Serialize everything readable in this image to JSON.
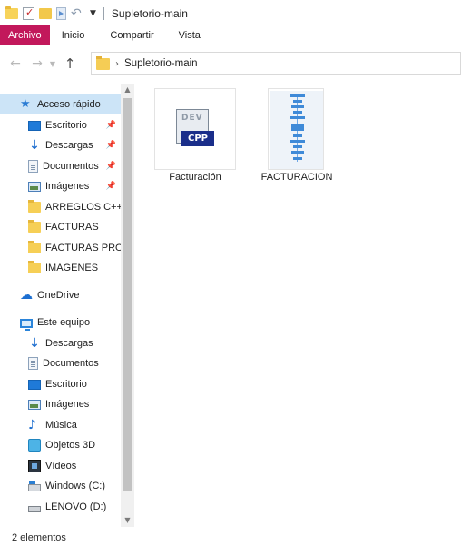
{
  "window": {
    "title": "Supletorio-main"
  },
  "quick_access_icons": [
    "folder-icon",
    "properties-icon",
    "new-folder-icon",
    "document-icon",
    "undo-icon",
    "chevron-down-icon"
  ],
  "ribbon": {
    "tabs": [
      {
        "label": "Archivo",
        "active": true,
        "color": "#c2185b"
      },
      {
        "label": "Inicio"
      },
      {
        "label": "Compartir"
      },
      {
        "label": "Vista"
      }
    ]
  },
  "address": {
    "path": [
      "Supletorio-main"
    ]
  },
  "sidebar": {
    "quick_access_label": "Acceso rápido",
    "quick_items": [
      {
        "label": "Escritorio",
        "icon": "desktop-icon",
        "pinned": true
      },
      {
        "label": "Descargas",
        "icon": "download-icon",
        "pinned": true
      },
      {
        "label": "Documentos",
        "icon": "documents-icon",
        "pinned": true
      },
      {
        "label": "Imágenes",
        "icon": "pictures-icon",
        "pinned": true
      },
      {
        "label": "ARREGLOS C++",
        "icon": "folder-icon"
      },
      {
        "label": "FACTURAS",
        "icon": "folder-icon"
      },
      {
        "label": "FACTURAS PROD",
        "icon": "folder-icon"
      },
      {
        "label": "IMAGENES",
        "icon": "folder-icon"
      }
    ],
    "onedrive_label": "OneDrive",
    "this_pc_label": "Este equipo",
    "pc_items": [
      {
        "label": "Descargas",
        "icon": "download-icon"
      },
      {
        "label": "Documentos",
        "icon": "documents-icon"
      },
      {
        "label": "Escritorio",
        "icon": "desktop-icon"
      },
      {
        "label": "Imágenes",
        "icon": "pictures-icon"
      },
      {
        "label": "Música",
        "icon": "music-icon"
      },
      {
        "label": "Objetos 3D",
        "icon": "objects-3d-icon"
      },
      {
        "label": "Vídeos",
        "icon": "videos-icon"
      },
      {
        "label": "Windows (C:)",
        "icon": "windows-drive-icon"
      },
      {
        "label": "LENOVO (D:)",
        "icon": "drive-icon"
      }
    ]
  },
  "files": [
    {
      "name": "Facturación",
      "icon": "cpp-file-icon",
      "badge": "CPP",
      "overlay": "DEV"
    },
    {
      "name": "FACTURACION",
      "icon": "executable-icon"
    }
  ],
  "status": {
    "item_count": "2 elementos"
  },
  "colors": {
    "accent": "#c2185b",
    "selection": "#cce4f7",
    "folder": "#f6cf56"
  }
}
